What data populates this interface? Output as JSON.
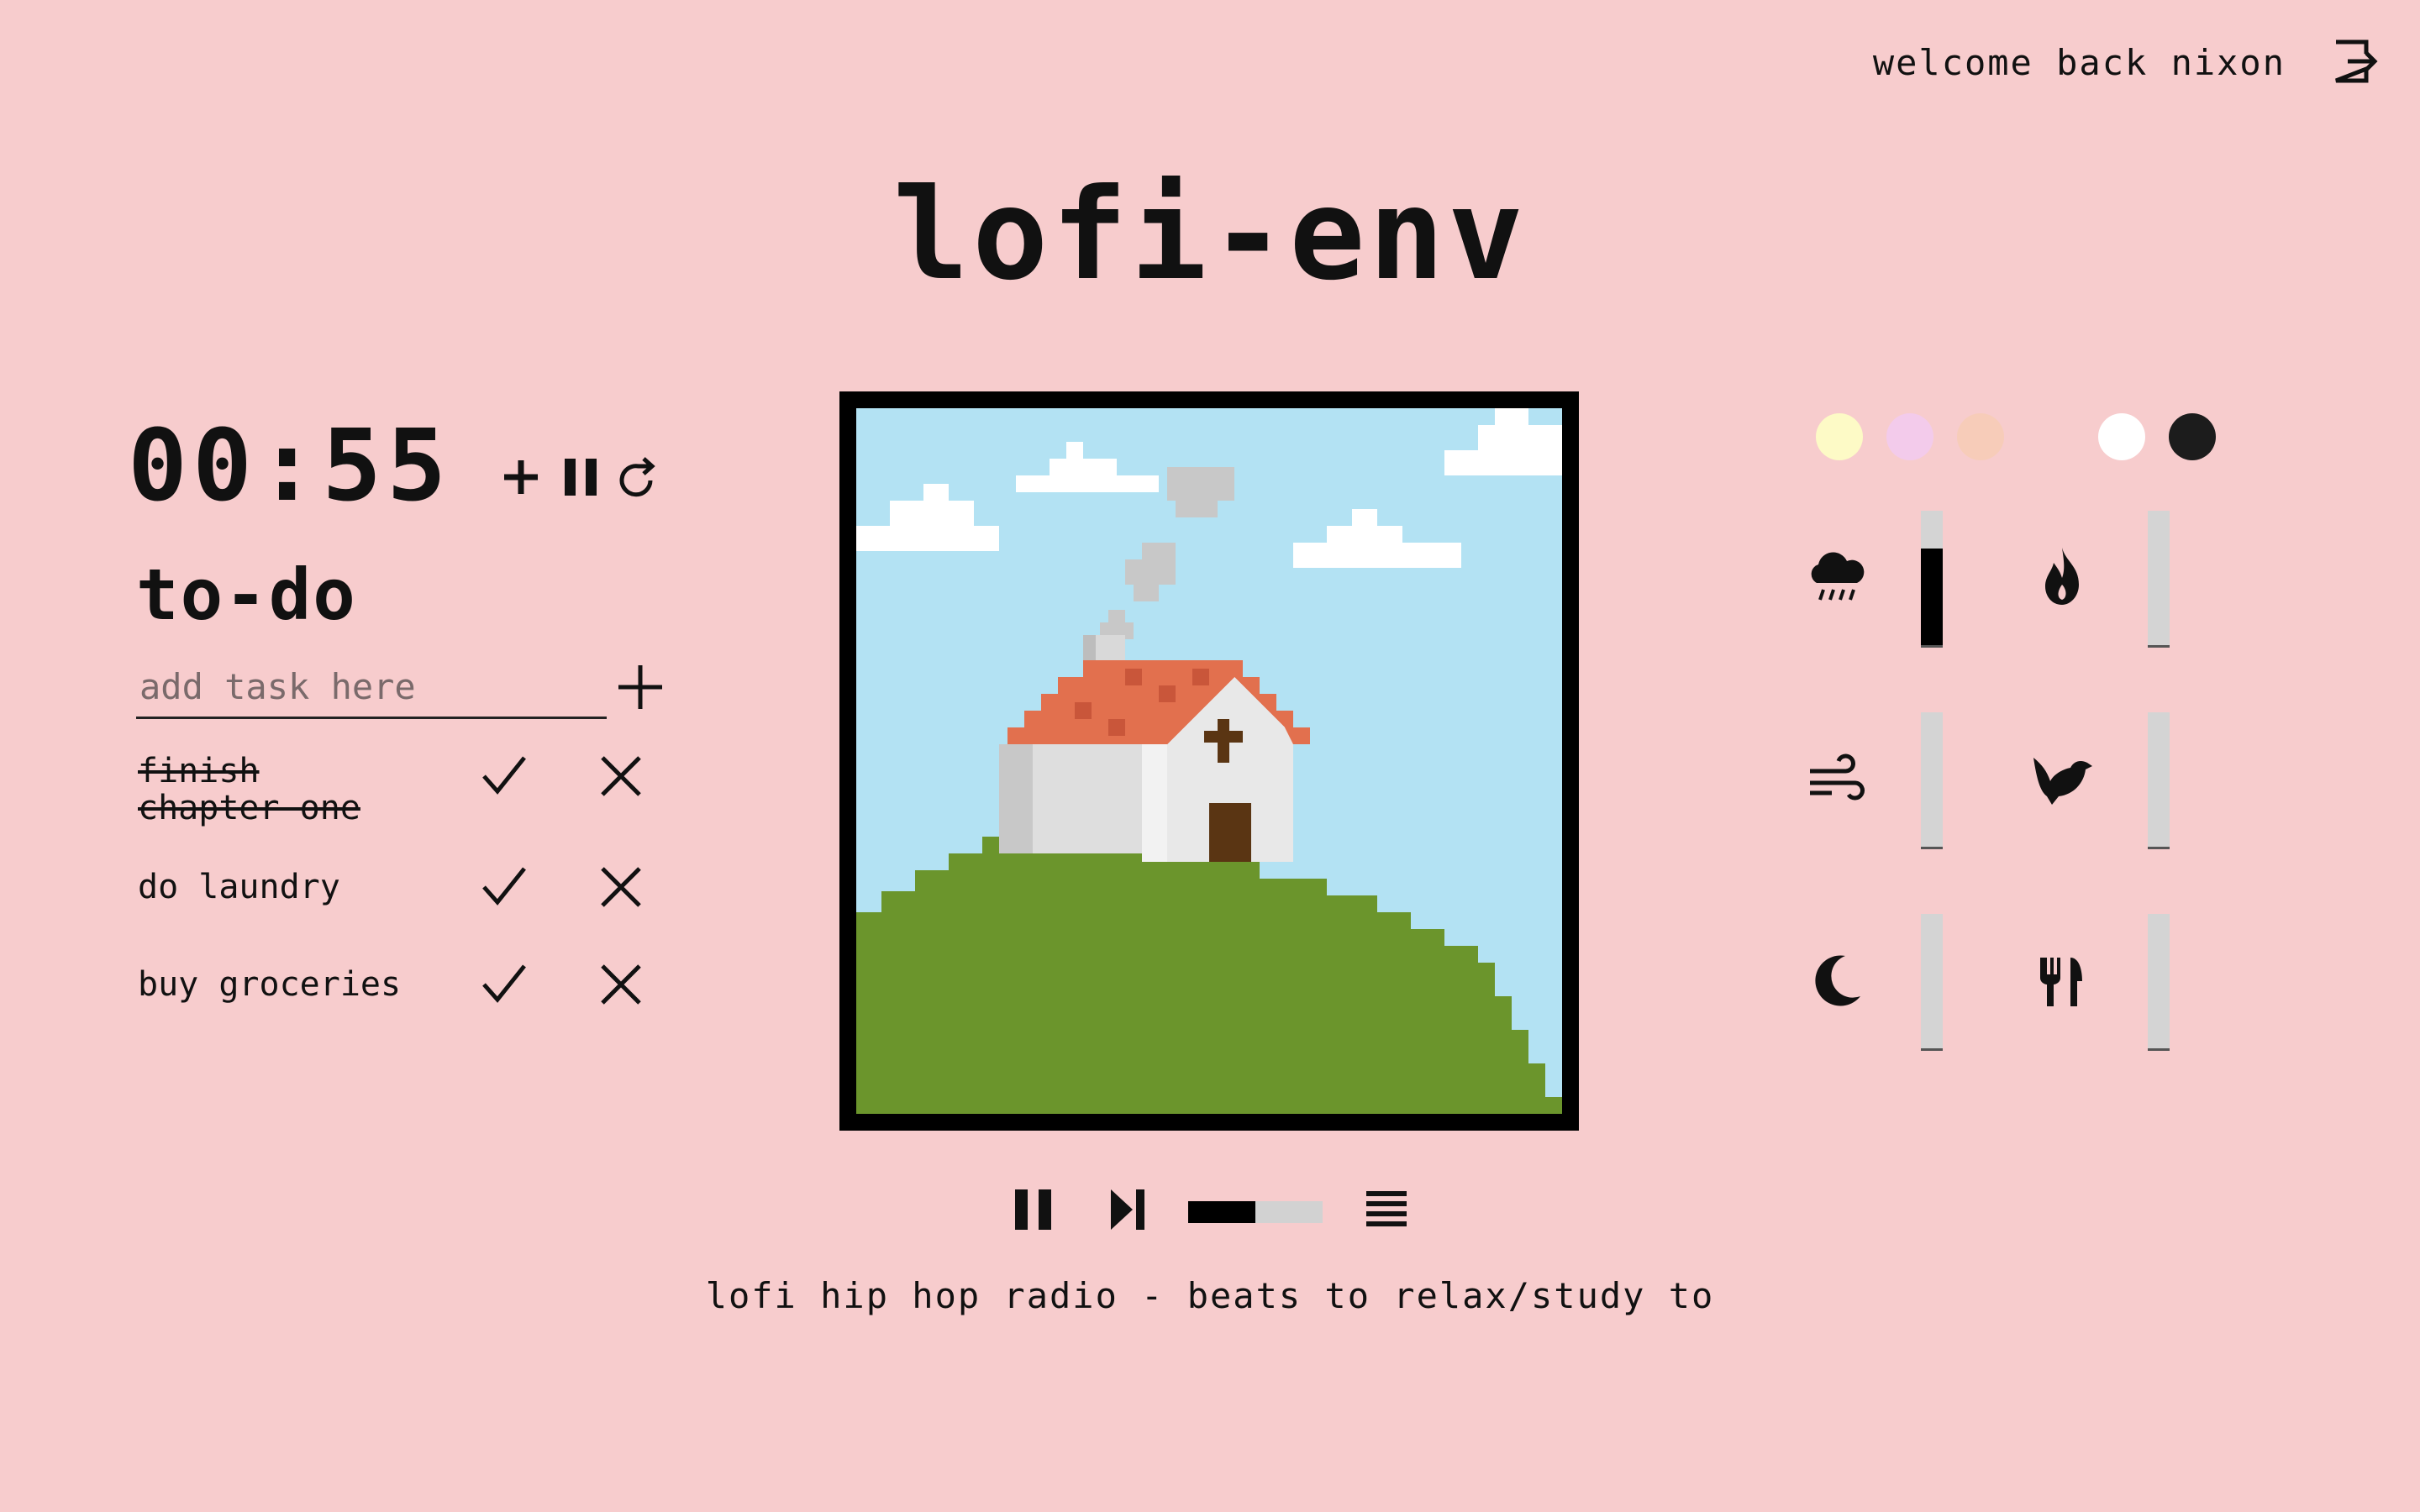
{
  "header": {
    "welcome_text": "welcome back nixon",
    "logout_icon": "logout-icon",
    "app_title": "lofi-env"
  },
  "timer": {
    "display": "00:55",
    "add_icon": "plus-icon",
    "pause_icon": "pause-icon",
    "reset_icon": "reset-icon"
  },
  "todo": {
    "heading": "to-do",
    "input_placeholder": "add task here",
    "input_value": "",
    "add_icon": "plus-icon",
    "tasks": [
      {
        "label": "finish chapter one",
        "done": true
      },
      {
        "label": "do laundry",
        "done": false
      },
      {
        "label": "buy groceries",
        "done": false
      }
    ]
  },
  "player": {
    "pause_icon": "pause-icon",
    "next_icon": "skip-next-icon",
    "progress": 0.5,
    "queue_icon": "queue-list-icon",
    "track_title": "lofi hip hop radio - beats to relax/study to",
    "artwork": "pixel-art-chapel-on-hill"
  },
  "themes": {
    "colors": [
      "#fdfac6",
      "#f3cbeb",
      "#f7ccb9",
      "#ffffff",
      "#1c1c1c"
    ]
  },
  "ambience": [
    {
      "name": "rain",
      "icon": "rain-cloud-icon",
      "level": 0.72
    },
    {
      "name": "fire",
      "icon": "fire-icon",
      "level": 0.0
    },
    {
      "name": "wind",
      "icon": "wind-icon",
      "level": 0.0
    },
    {
      "name": "birds",
      "icon": "bird-icon",
      "level": 0.0
    },
    {
      "name": "night",
      "icon": "moon-icon",
      "level": 0.0
    },
    {
      "name": "cafe",
      "icon": "utensils-icon",
      "level": 0.0
    }
  ]
}
